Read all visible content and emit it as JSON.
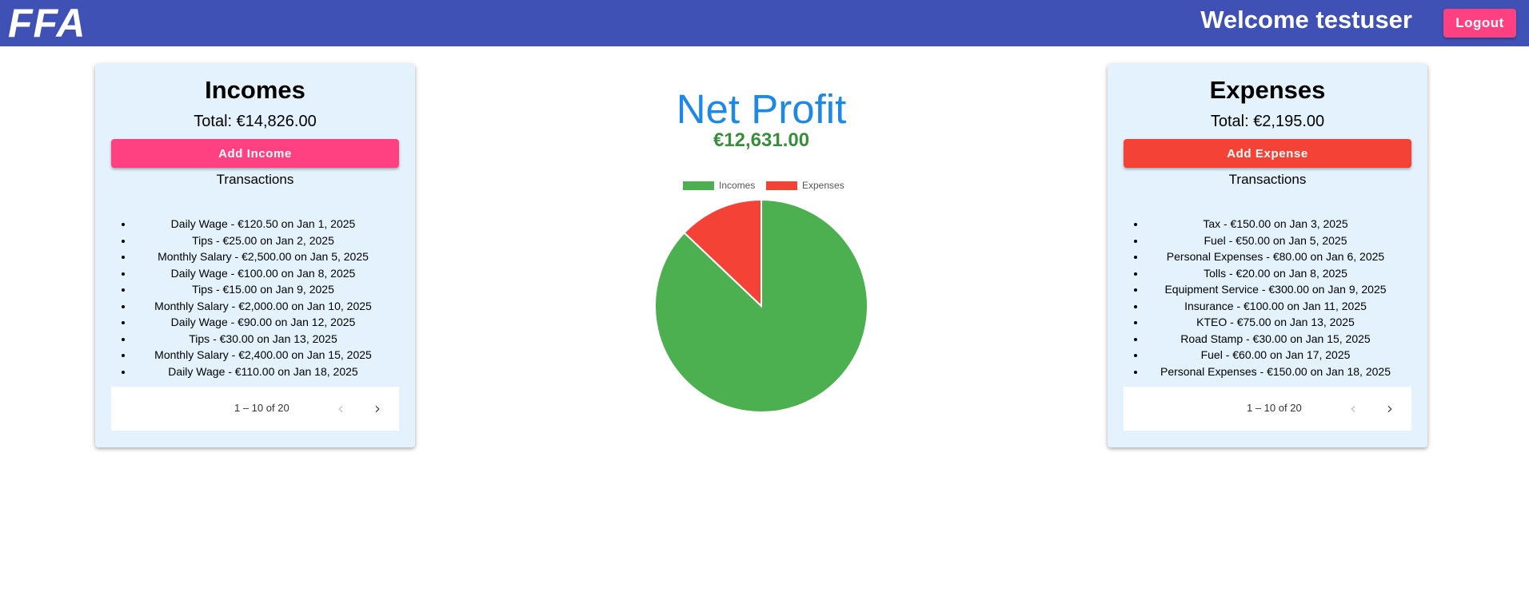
{
  "header": {
    "brand": "FFA",
    "welcome": "Welcome testuser",
    "logout_label": "Logout"
  },
  "colors": {
    "header_bg": "#3f51b5",
    "accent_pink": "#ff4081",
    "expense_red": "#f44336",
    "income_green": "#4caf50",
    "net_blue": "#1e88e5",
    "net_value_green": "#388e3c",
    "card_bg": "#e3f2fd"
  },
  "incomes": {
    "title": "Incomes",
    "total": "Total: €14,826.00",
    "add_label": "Add Income",
    "subtitle": "Transactions",
    "transactions": [
      "Daily Wage - €120.50 on Jan 1, 2025",
      "Tips - €25.00 on Jan 2, 2025",
      "Monthly Salary - €2,500.00 on Jan 5, 2025",
      "Daily Wage - €100.00 on Jan 8, 2025",
      "Tips - €15.00 on Jan 9, 2025",
      "Monthly Salary - €2,000.00 on Jan 10, 2025",
      "Daily Wage - €90.00 on Jan 12, 2025",
      "Tips - €30.00 on Jan 13, 2025",
      "Monthly Salary - €2,400.00 on Jan 15, 2025",
      "Daily Wage - €110.00 on Jan 18, 2025"
    ],
    "paginator": {
      "range": "1 – 10 of 20",
      "prev_icon": "chevron-left-icon",
      "next_icon": "chevron-right-icon",
      "prev_disabled": true
    }
  },
  "expenses": {
    "title": "Expenses",
    "total": "Total: €2,195.00",
    "add_label": "Add Expense",
    "subtitle": "Transactions",
    "transactions": [
      "Tax - €150.00 on Jan 3, 2025",
      "Fuel - €50.00 on Jan 5, 2025",
      "Personal Expenses - €80.00 on Jan 6, 2025",
      "Tolls - €20.00 on Jan 8, 2025",
      "Equipment Service - €300.00 on Jan 9, 2025",
      "Insurance - €100.00 on Jan 11, 2025",
      "KTEO - €75.00 on Jan 13, 2025",
      "Road Stamp - €30.00 on Jan 15, 2025",
      "Fuel - €60.00 on Jan 17, 2025",
      "Personal Expenses - €150.00 on Jan 18, 2025"
    ],
    "paginator": {
      "range": "1 – 10 of 20",
      "prev_icon": "chevron-left-icon",
      "next_icon": "chevron-right-icon",
      "prev_disabled": true
    }
  },
  "summary": {
    "title": "Net Profit",
    "value": "€12,631.00"
  },
  "chart_data": {
    "type": "pie",
    "categories": [
      "Incomes",
      "Expenses"
    ],
    "values": [
      14826,
      2195
    ],
    "colors": [
      "#4caf50",
      "#f44336"
    ],
    "legend": "top",
    "title": ""
  }
}
